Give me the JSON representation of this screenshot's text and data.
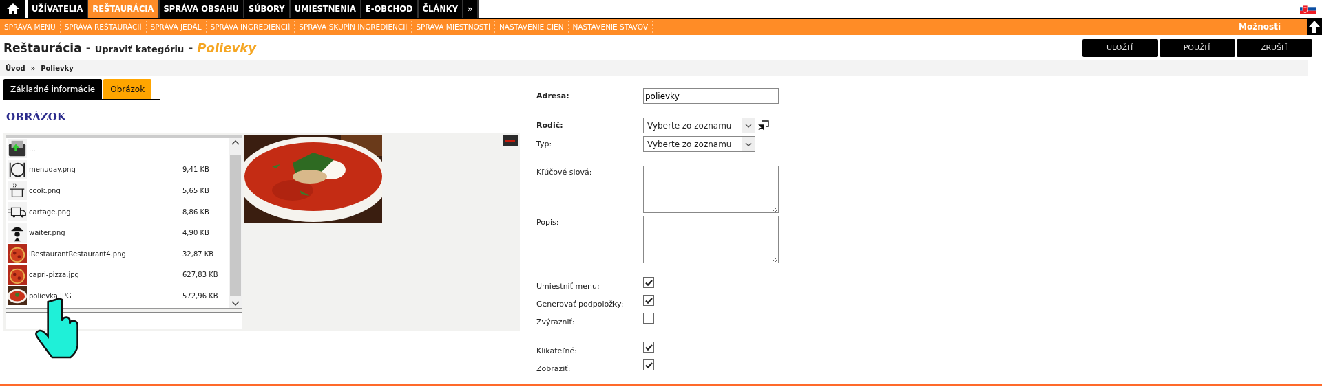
{
  "nav": [
    {
      "label": "UŽÍVATELIA",
      "selected": false
    },
    {
      "label": "REŠTAURÁCIA",
      "selected": true
    },
    {
      "label": "SPRÁVA OBSAHU",
      "selected": false
    },
    {
      "label": "SÚBORY",
      "selected": false
    },
    {
      "label": "UMIESTNENIA",
      "selected": false
    },
    {
      "label": "E-OBCHOD",
      "selected": false
    },
    {
      "label": "ČLÁNKY",
      "selected": false
    },
    {
      "label": "»",
      "selected": false
    }
  ],
  "subnav": [
    "SPRÁVA MENU",
    "SPRÁVA REŠTAURÁCIÍ",
    "SPRÁVA JEDÁL",
    "SPRÁVA INGREDIENCIÍ",
    "SPRÁVA SKUPÍN INGREDIENCIÍ",
    "SPRÁVA MIESTNOSTÍ",
    "NASTAVENIE CIEN",
    "NASTAVENIE STAVOV"
  ],
  "options_label": "Možnosti",
  "title": [
    {
      "kind": "module",
      "text": "Reštaurácia"
    },
    {
      "kind": "sep",
      "text": "-"
    },
    {
      "kind": "action",
      "text": "Upraviť kategóriu"
    },
    {
      "kind": "sep",
      "text": "-"
    },
    {
      "kind": "item",
      "text": "Polievky"
    }
  ],
  "buttons": [
    "ULOŽIŤ",
    "POUŽIŤ",
    "ZRUŠIŤ"
  ],
  "breadcrumb": {
    "items": [
      "Úvod",
      "Polievky"
    ],
    "separator": "»"
  },
  "tabs": [
    {
      "label": "Základné informácie",
      "selected": false
    },
    {
      "label": "Obrázok",
      "selected": true
    }
  ],
  "section_heading": "OBRÁZOK",
  "files": [
    {
      "kind": "folder",
      "name": "..."
    },
    {
      "kind": "plate",
      "name": "menuday.png",
      "size": "9,41 KB"
    },
    {
      "kind": "pot",
      "name": "cook.png",
      "size": "5,65 KB"
    },
    {
      "kind": "truck",
      "name": "cartage.png",
      "size": "8,86 KB"
    },
    {
      "kind": "waiter",
      "name": "waiter.png",
      "size": "4,90 KB"
    },
    {
      "kind": "pizza",
      "name": "lRestaurantRestaurant4.png",
      "size": "32,87 KB"
    },
    {
      "kind": "pizza",
      "name": "capri-pizza.jpg",
      "size": "627,83 KB"
    },
    {
      "kind": "soup",
      "name": "polievka.JPG",
      "size": "572,96 KB"
    }
  ],
  "preview": {
    "kind": "picture"
  },
  "form": [
    [
      {
        "kind": "text",
        "label": "Adresa:",
        "emphasis": true,
        "value": "polievky"
      }
    ],
    [
      {
        "kind": "select",
        "label": "Rodič:",
        "emphasis": true,
        "value": "Vyberte zo zoznamu",
        "picker": true
      },
      {
        "kind": "select",
        "label": "Typ:",
        "emphasis": false,
        "value": "Vyberte zo zoznamu",
        "picker": false
      }
    ],
    [
      {
        "kind": "textarea",
        "label": "Kľúčové slová:",
        "emphasis": false
      },
      {
        "kind": "textarea",
        "label": "Popis:",
        "emphasis": false
      }
    ],
    [
      {
        "kind": "checkbox",
        "label": "Umiestniť menu:",
        "emphasis": false,
        "checked": true
      },
      {
        "kind": "checkbox",
        "label": "Generovať podpoložky:",
        "emphasis": false,
        "checked": true
      },
      {
        "kind": "checkbox",
        "label": "Zvýrazniť:",
        "emphasis": false,
        "checked": false
      }
    ],
    [
      {
        "kind": "checkbox",
        "label": "Klikateľné:",
        "emphasis": false,
        "checked": true
      },
      {
        "kind": "checkbox",
        "label": "Zobraziť:",
        "emphasis": false,
        "checked": true
      }
    ]
  ]
}
